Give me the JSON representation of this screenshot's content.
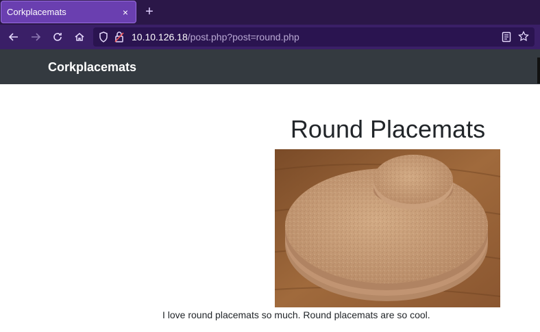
{
  "browser": {
    "tab": {
      "title": "Corkplacemats",
      "close_glyph": "×"
    },
    "new_tab_glyph": "+",
    "url": {
      "host": "10.10.126.18",
      "path": "/post.php?post=round.php"
    },
    "accent": "#6a3fb0"
  },
  "site": {
    "brand": "Corkplacemats",
    "navbar_color": "#343a40"
  },
  "post": {
    "title": "Round Placemats",
    "image_icon": "cork-placemat-photo",
    "body": "I love round placemats so much. Round placemats are so cool."
  }
}
